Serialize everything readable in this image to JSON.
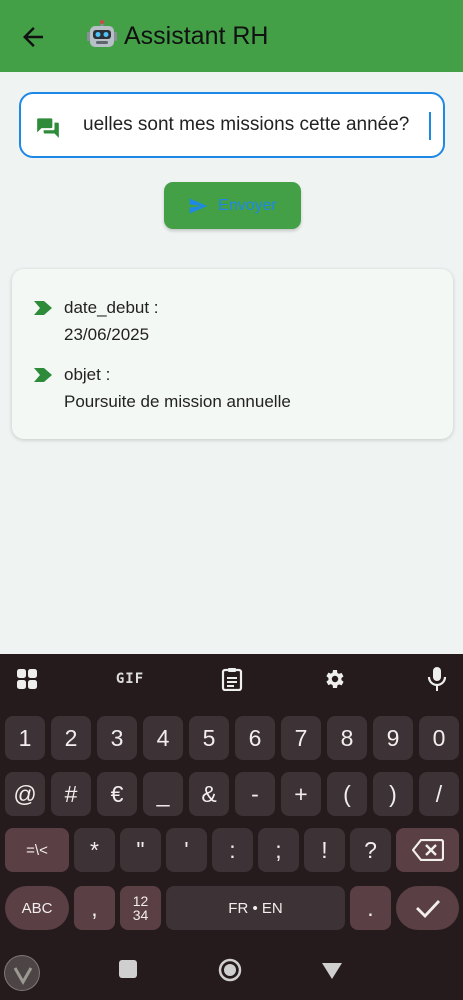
{
  "appbar": {
    "title": "Assistant RH",
    "robot_icon": "robot-emoji",
    "back_icon": "arrow-back-icon"
  },
  "input": {
    "value": "uelles sont mes missions cette année?"
  },
  "send": {
    "label": "Envoyer"
  },
  "result": {
    "items": [
      {
        "key": "date_debut :",
        "value": "23/06/2025"
      },
      {
        "key": "objet :",
        "value": "Poursuite de mission annuelle"
      }
    ]
  },
  "keyboard": {
    "toolbar": {
      "gif": "GIF"
    },
    "row1": [
      "1",
      "2",
      "3",
      "4",
      "5",
      "6",
      "7",
      "8",
      "9",
      "0"
    ],
    "row2": [
      "@",
      "#",
      "€",
      "_",
      "&",
      "-",
      "+",
      "(",
      ")",
      "/"
    ],
    "row3": [
      "=\\<",
      "*",
      "\"",
      "'",
      ":",
      ";",
      "!",
      "?"
    ],
    "row4": {
      "abc": "ABC",
      "comma": ",",
      "num_top": "12",
      "num_bottom": "34",
      "space": "FR • EN",
      "period": "."
    }
  },
  "colors": {
    "appbar": "#43a047",
    "accent": "#1e88e5",
    "keyboard_bg": "#251a1c",
    "key_bg": "#3d3235",
    "key_dark": "#5a3f45"
  }
}
